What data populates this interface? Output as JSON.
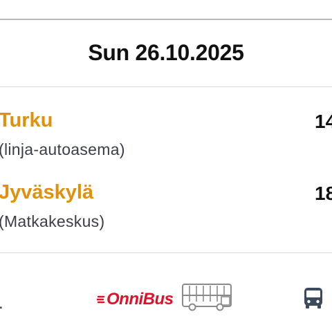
{
  "date": "Sun 26.10.2025",
  "departure": {
    "city": "Turku",
    "station": "(linja-autoasema)",
    "time": "14"
  },
  "arrival": {
    "city": "Jyväskylä",
    "station": "(Matkakeskus)",
    "time": "18"
  },
  "footer": {
    "leading_mark": ".",
    "operator_logo_text": "OnniBus",
    "operator_logo_color": "#e0102a",
    "vehicle_graphic": "double-decker-bus-graphic",
    "transport_icon": "bus-icon"
  },
  "colors": {
    "city": "#e0900b",
    "text": "#111111",
    "secondary": "#3a3f47"
  }
}
